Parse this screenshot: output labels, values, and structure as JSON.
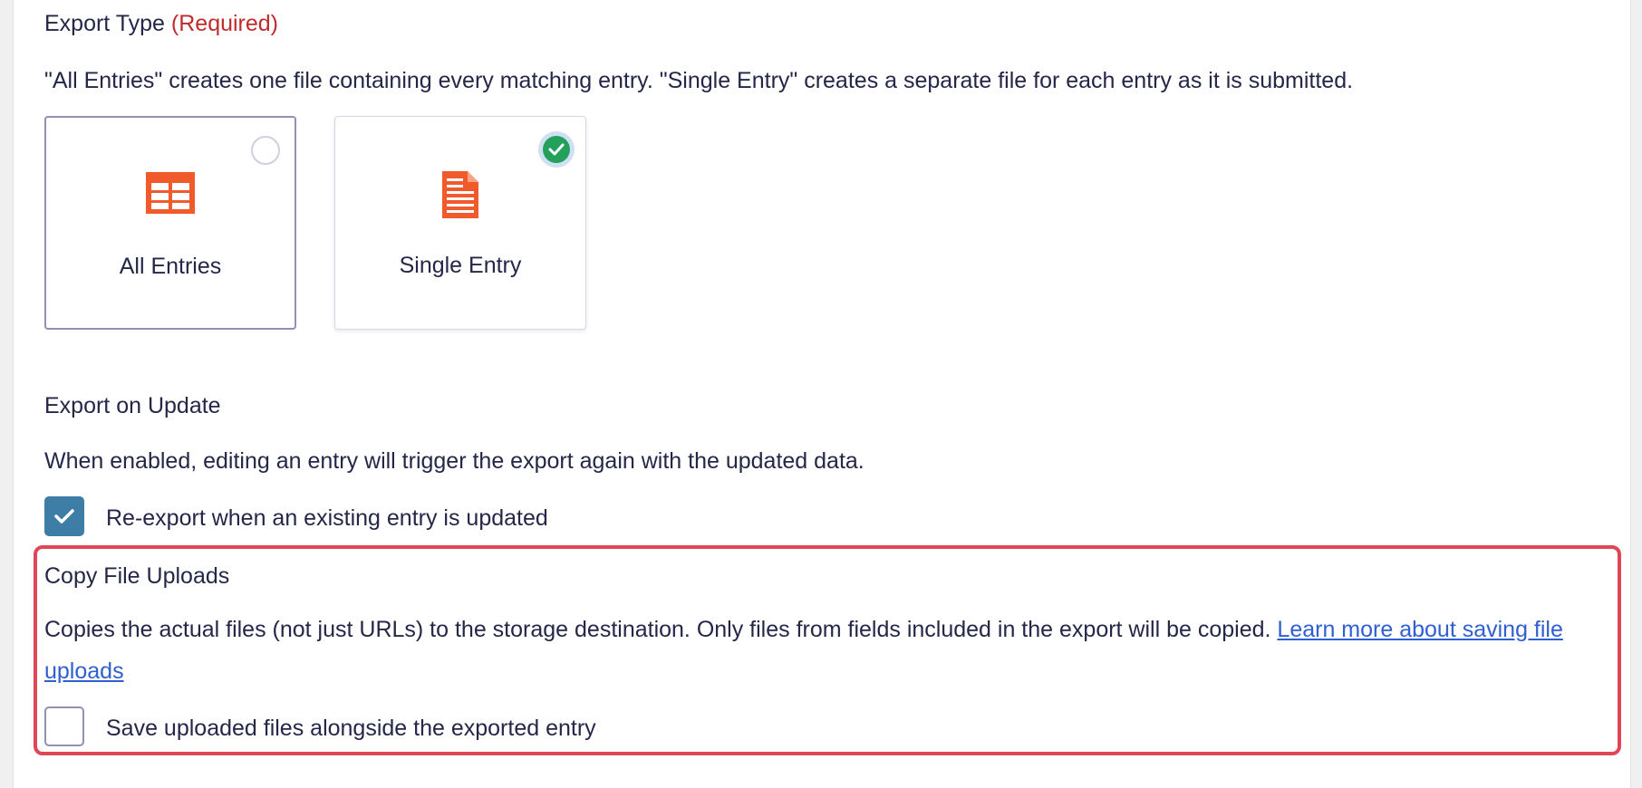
{
  "export_type": {
    "label": "Export Type",
    "required": "(Required)",
    "description": "\"All Entries\" creates one file containing every matching entry. \"Single Entry\" creates a separate file for each entry as it is submitted.",
    "options": [
      {
        "label": "All Entries",
        "icon": "table-icon",
        "selected": false
      },
      {
        "label": "Single Entry",
        "icon": "document-icon",
        "selected": true
      }
    ]
  },
  "export_on_update": {
    "label": "Export on Update",
    "description": "When enabled, editing an entry will trigger the export again with the updated data.",
    "checkbox_label": "Re-export when an existing entry is updated",
    "checked": true
  },
  "copy_file_uploads": {
    "label": "Copy File Uploads",
    "description": "Copies the actual files (not just URLs) to the storage destination. Only files from fields included in the export will be copied.",
    "link_text": "Learn more about saving file uploads",
    "checkbox_label": "Save uploaded files alongside the exported entry",
    "checked": false
  },
  "colors": {
    "accent_icon": "#f15a2b",
    "required": "#c02b2b",
    "checkbox": "#3e7da6",
    "radio_selected": "#23a05a",
    "highlight_border": "#e04756",
    "link": "#2f5fd0"
  }
}
